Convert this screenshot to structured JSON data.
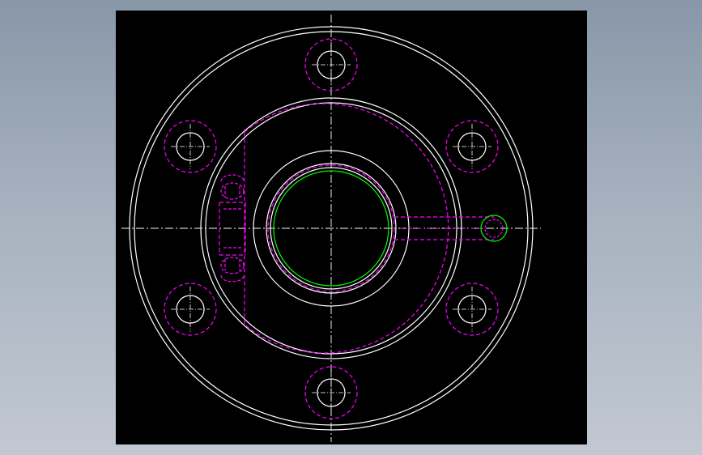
{
  "colors": {
    "background_gradient_top": "#8897a8",
    "background_gradient_bottom": "#c2c8d2",
    "viewport": "#000000",
    "outline": "#ffffff",
    "hidden_lines": "#ff00ff",
    "highlight": "#00ff00",
    "centerlines": "#ffffff"
  },
  "drawing": {
    "type": "flange-top-view",
    "bolt_hole_count": 6,
    "line_styles": {
      "outline": "solid",
      "hidden_lines": "dashed",
      "centerlines": "dash-dot"
    }
  }
}
